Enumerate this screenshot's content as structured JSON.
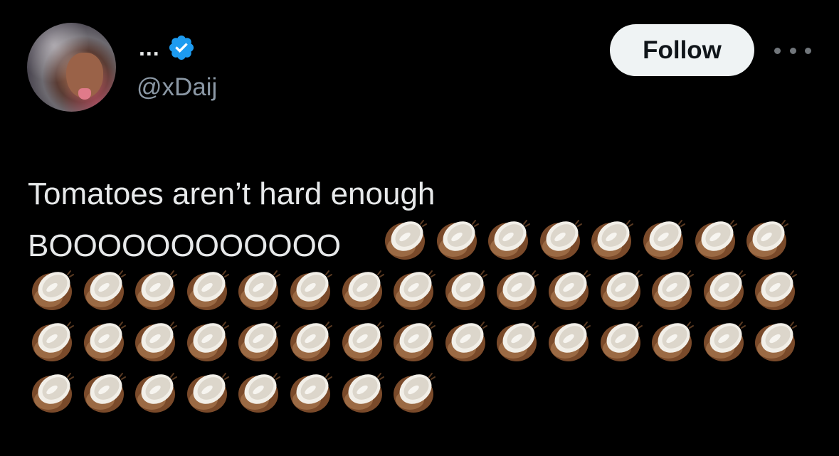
{
  "author": {
    "display_name": "...",
    "handle": "@xDaij",
    "verified": true,
    "avatar_icon": "profile-photo"
  },
  "actions": {
    "follow_label": "Follow",
    "more_icon": "more-horizontal-icon"
  },
  "tweet": {
    "line1": "Tomatoes aren’t hard enough",
    "line2_text": "BOOOOOOOOOOOO",
    "emoji": "🥥",
    "emoji_name": "coconut-emoji",
    "emoji_rows": [
      8,
      15,
      15,
      8
    ]
  },
  "colors": {
    "background": "#000000",
    "text": "#e7e9ea",
    "secondary_text": "#8b98a5",
    "verified_blue": "#1d9bf0",
    "follow_bg": "#eff3f4"
  }
}
